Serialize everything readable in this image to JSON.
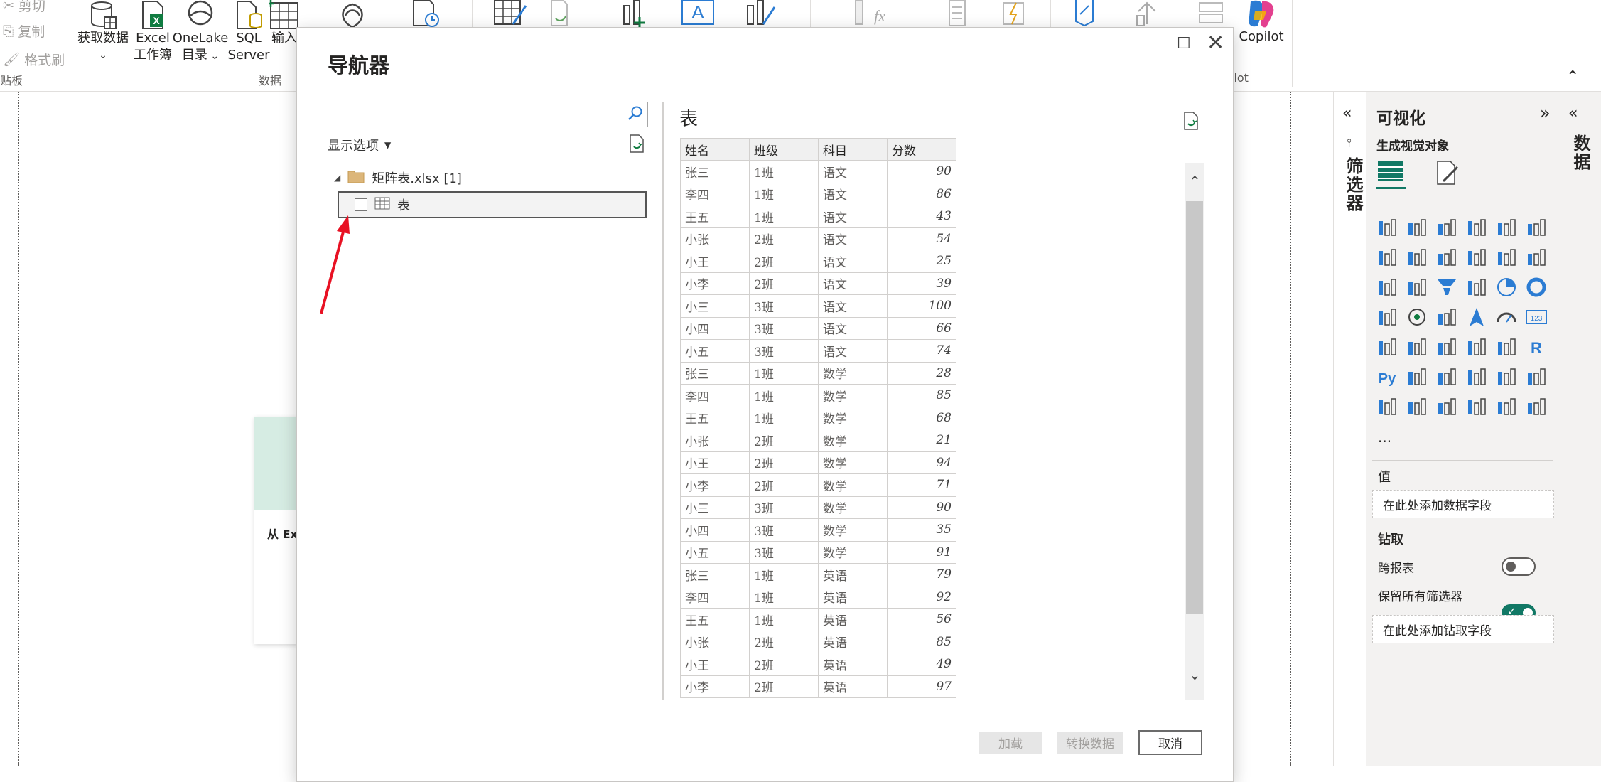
{
  "ribbon": {
    "clipboard": {
      "cut": "剪切",
      "copy": "复制",
      "format_painter": "格式刷",
      "group_label": "贴板"
    },
    "data_group": {
      "get_data": "获取数据",
      "excel_line1": "Excel",
      "excel_line2": "工作簿",
      "onelake_line1": "OneLake",
      "onelake_line2": "目录",
      "sql_line1": "SQL",
      "sql_line2": "Server",
      "input": "输入",
      "group_label": "数据"
    },
    "copilot": {
      "label": "Copilot",
      "group_label": "ilot"
    }
  },
  "canvas": {
    "card_text": "从 Exc"
  },
  "dialog": {
    "title": "导航器",
    "search": {
      "value": "",
      "placeholder": ""
    },
    "display_options": "显示选项",
    "tree": {
      "file": "矩阵表.xlsx [1]",
      "item": "表"
    },
    "preview": {
      "title": "表",
      "columns": [
        "姓名",
        "班级",
        "科目",
        "分数"
      ],
      "rows": [
        [
          "张三",
          "1班",
          "语文",
          "90"
        ],
        [
          "李四",
          "1班",
          "语文",
          "86"
        ],
        [
          "王五",
          "1班",
          "语文",
          "43"
        ],
        [
          "小张",
          "2班",
          "语文",
          "54"
        ],
        [
          "小王",
          "2班",
          "语文",
          "25"
        ],
        [
          "小李",
          "2班",
          "语文",
          "39"
        ],
        [
          "小三",
          "3班",
          "语文",
          "100"
        ],
        [
          "小四",
          "3班",
          "语文",
          "66"
        ],
        [
          "小五",
          "3班",
          "语文",
          "74"
        ],
        [
          "张三",
          "1班",
          "数学",
          "28"
        ],
        [
          "李四",
          "1班",
          "数学",
          "85"
        ],
        [
          "王五",
          "1班",
          "数学",
          "68"
        ],
        [
          "小张",
          "2班",
          "数学",
          "21"
        ],
        [
          "小王",
          "2班",
          "数学",
          "94"
        ],
        [
          "小李",
          "2班",
          "数学",
          "71"
        ],
        [
          "小三",
          "3班",
          "数学",
          "90"
        ],
        [
          "小四",
          "3班",
          "数学",
          "35"
        ],
        [
          "小五",
          "3班",
          "数学",
          "91"
        ],
        [
          "张三",
          "1班",
          "英语",
          "79"
        ],
        [
          "李四",
          "1班",
          "英语",
          "92"
        ],
        [
          "王五",
          "1班",
          "英语",
          "56"
        ],
        [
          "小张",
          "2班",
          "英语",
          "85"
        ],
        [
          "小王",
          "2班",
          "英语",
          "49"
        ],
        [
          "小李",
          "2班",
          "英语",
          "97"
        ]
      ]
    },
    "buttons": {
      "load": "加载",
      "transform": "转换数据",
      "cancel": "取消"
    }
  },
  "filters_pane": {
    "label": "筛选器"
  },
  "viz_pane": {
    "title": "可视化",
    "build_visual": "生成视觉对象",
    "values_label": "值",
    "values_well": "在此处添加数据字段",
    "drill_label": "钻取",
    "cross_report": "跨报表",
    "keep_filters": "保留所有筛选器",
    "drill_well": "在此处添加钻取字段",
    "more": "..."
  },
  "data_pane": {
    "label": "数据"
  },
  "colors": {
    "accent_green": "#117865",
    "arrow_red": "#e81123",
    "icon_blue": "#2b7cd3"
  }
}
